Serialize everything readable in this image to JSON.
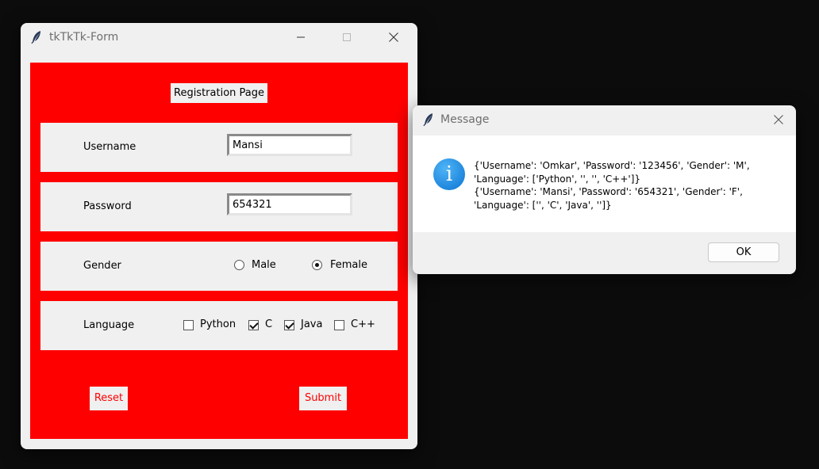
{
  "main_window": {
    "title": "tkTkTk-Form",
    "icon": "feather-icon",
    "heading": "Registration Page",
    "background_color": "#ff0000",
    "username": {
      "label": "Username",
      "value": "Mansi"
    },
    "password": {
      "label": "Password",
      "value": "654321"
    },
    "gender": {
      "label": "Gender",
      "options": [
        {
          "label": "Male",
          "selected": false
        },
        {
          "label": "Female",
          "selected": true
        }
      ]
    },
    "language": {
      "label": "Language",
      "options": [
        {
          "label": "Python",
          "checked": false
        },
        {
          "label": "C",
          "checked": true
        },
        {
          "label": "Java",
          "checked": true
        },
        {
          "label": "C++",
          "checked": false
        }
      ]
    },
    "reset_label": "Reset",
    "submit_label": "Submit"
  },
  "message_window": {
    "title": "Message",
    "icon": "info-icon",
    "text": "{'Username': 'Omkar', 'Password': '123456', 'Gender': 'M',\n'Language': ['Python', '', '', 'C++']}\n{'Username': 'Mansi', 'Password': '654321', 'Gender': 'F',\n'Language': ['', 'C', 'Java', '']}",
    "ok_label": "OK"
  }
}
